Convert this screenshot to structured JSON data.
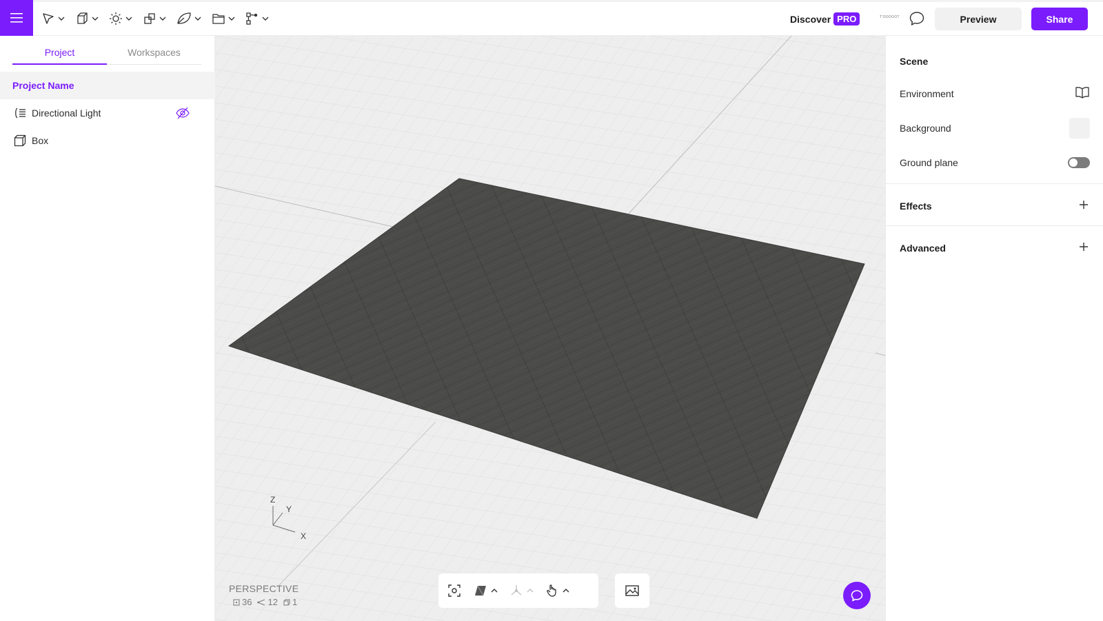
{
  "colors": {
    "accent": "#7b1cfc",
    "floor": "#4a4a48",
    "grid_bg": "#ededed"
  },
  "topbar": {
    "tools": [
      {
        "icon": "select-arrow-icon"
      },
      {
        "icon": "cube-icon"
      },
      {
        "icon": "sun-light-icon"
      },
      {
        "icon": "transform-shapes-icon"
      },
      {
        "icon": "material-leaf-icon"
      },
      {
        "icon": "folder-icon"
      },
      {
        "icon": "node-graph-icon"
      }
    ],
    "discover_label": "Discover",
    "pro_label": "PRO",
    "brand_mark": "T'OOOOOT",
    "preview_label": "Preview",
    "share_label": "Share"
  },
  "left_panel": {
    "tabs": [
      {
        "label": "Project",
        "active": true
      },
      {
        "label": "Workspaces",
        "active": false
      }
    ],
    "project_name": "Project Name",
    "items": [
      {
        "label": "Directional Light",
        "icon": "directional-light-icon",
        "hidden": true
      },
      {
        "label": "Box",
        "icon": "box-icon"
      }
    ]
  },
  "viewport": {
    "axis_labels": {
      "z": "Z",
      "y": "Y",
      "x": "X"
    },
    "camera_mode": "PERSPECTIVE",
    "stats": {
      "vertices": "36",
      "edges": "12",
      "objects": "1"
    }
  },
  "right_panel": {
    "scene_heading": "Scene",
    "environment_label": "Environment",
    "background_label": "Background",
    "ground_plane_label": "Ground plane",
    "ground_plane_on": false,
    "effects_heading": "Effects",
    "advanced_heading": "Advanced"
  }
}
